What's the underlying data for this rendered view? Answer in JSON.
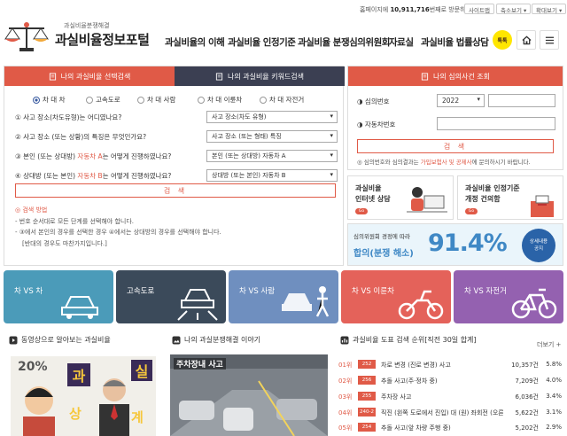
{
  "util": {
    "visit_prefix": "홈페이지에",
    "visit_count": "10,911,716",
    "visit_suffix": "번째로 방문하셨습니다.",
    "sitemap": "사이트맵",
    "zoom": "축소보기",
    "zoom_in": "확대보기"
  },
  "logo": {
    "sub": "과실비율분쟁해결",
    "main": "과실비율정보포털"
  },
  "nav": [
    "과실비율의 이해",
    "과실비율 인정기준",
    "과실비율 분쟁심의위원회",
    "자료실",
    "과실비율 법률상담"
  ],
  "talk_label": "톡톡",
  "icons": {
    "home": "home-icon",
    "menu": "menu-icon",
    "talk": "kakao-talk-icon"
  },
  "left_tabs": [
    "나의 과실비율 선택검색",
    "나의 과실비율 키워드검색"
  ],
  "radios": {
    "options": [
      "차 대 차",
      "고속도로",
      "차 대 사람",
      "차 대 이륜차",
      "차 대 자전거"
    ],
    "selected": 0
  },
  "questions": [
    {
      "prefix": "① 사고 장소(차도유형)는 어디였나요?",
      "hl": "",
      "suffix": "",
      "answer": "사고 장소(차도 유형)"
    },
    {
      "prefix": "② 사고 장소 (또는 상황)의 특징은 무엇인가요?",
      "hl": "",
      "suffix": "",
      "answer": "사고 장소 (또는 형태) 특징"
    },
    {
      "prefix": "③ 본인 (또는 상대방)",
      "hl": "자동차 A",
      "suffix": "는 어떻게 진행하였나요?",
      "answer": "본인 (또는 상대방) 자동차 A"
    },
    {
      "prefix": "④ 상대방 (또는 본인)",
      "hl": "자동차 B",
      "suffix": "는 어떻게 진행하였나요?",
      "answer": "상대방 (또는 본인) 자동차 B"
    }
  ],
  "search_label": "검 색",
  "guide": {
    "title": "◎ 검색 방법",
    "lines": [
      "- 번호 순서대로 모든 단계를 선택해야 합니다.",
      "- ③에서 본인의 경우를 선택한 경우 ④에서는 상대방의 경우를 선택해야 합니다.",
      "[반대의 경우도 마찬가지입니다.]"
    ]
  },
  "right": {
    "tab": "나의 심의사건 조회",
    "label1": "◑ 심의번호",
    "year": "2022",
    "label2": "◑ 자동차번호",
    "search": "검 색",
    "note_prefix": "◎ 심의번호와 심의결과는",
    "note_hl": "가입보험사 및 공제사",
    "note_suffix": "에 문의하시기 바랍니다."
  },
  "banners": [
    {
      "l1": "과실비율",
      "l2": "인터넷 상담",
      "go": "Go"
    },
    {
      "l1": "과실비율 인정기준",
      "l2": "개정 건의함",
      "go": "Go"
    }
  ],
  "stat": {
    "a": "심의위원회 경정에 따라",
    "b": "합의(분쟁 해소)",
    "value": "91.4%",
    "circle1": "상세내용",
    "circle2": "공지"
  },
  "tiles": [
    {
      "label": "차 VS 차",
      "color": "#4b9bb9"
    },
    {
      "label": "고속도로",
      "color": "#3b4a5a"
    },
    {
      "label": "차 VS 사람",
      "color": "#6f8fbf"
    },
    {
      "label": "차 VS 이륜차",
      "color": "#e4625a"
    },
    {
      "label": "차 VS 자전거",
      "color": "#9461b0"
    }
  ],
  "video": {
    "title": "동영상으로 알아보는 과실비율",
    "t1": "20%",
    "t2": "과",
    "t3": "실",
    "t4": "상",
    "t5": "계"
  },
  "story": {
    "title": "나의 과실분쟁해결 이야기",
    "sign": "주차장내 사고"
  },
  "rank": {
    "title": "과실비율 도표 검색 순위[직전 30일 합계]",
    "more": "더보기 +",
    "rows": [
      {
        "rank": "01위",
        "code": "252",
        "title": "차로 변경 (진로 변경) 사고",
        "count": "10,357건",
        "pct": "5.8%"
      },
      {
        "rank": "02위",
        "code": "256",
        "title": "추돌 사고(주·정차 중)",
        "count": "7,209건",
        "pct": "4.0%"
      },
      {
        "rank": "03위",
        "code": "255",
        "title": "주차장 사고",
        "count": "6,036건",
        "pct": "3.4%"
      },
      {
        "rank": "04위",
        "code": "240-2",
        "title": "직진 (왼쪽 도로에서 진입) 대 (원) 좌회전 (오른…",
        "count": "5,622건",
        "pct": "3.1%"
      },
      {
        "rank": "05위",
        "code": "254",
        "title": "추돌 사고(앞 차량 주행 중)",
        "count": "5,202건",
        "pct": "2.9%"
      }
    ]
  }
}
